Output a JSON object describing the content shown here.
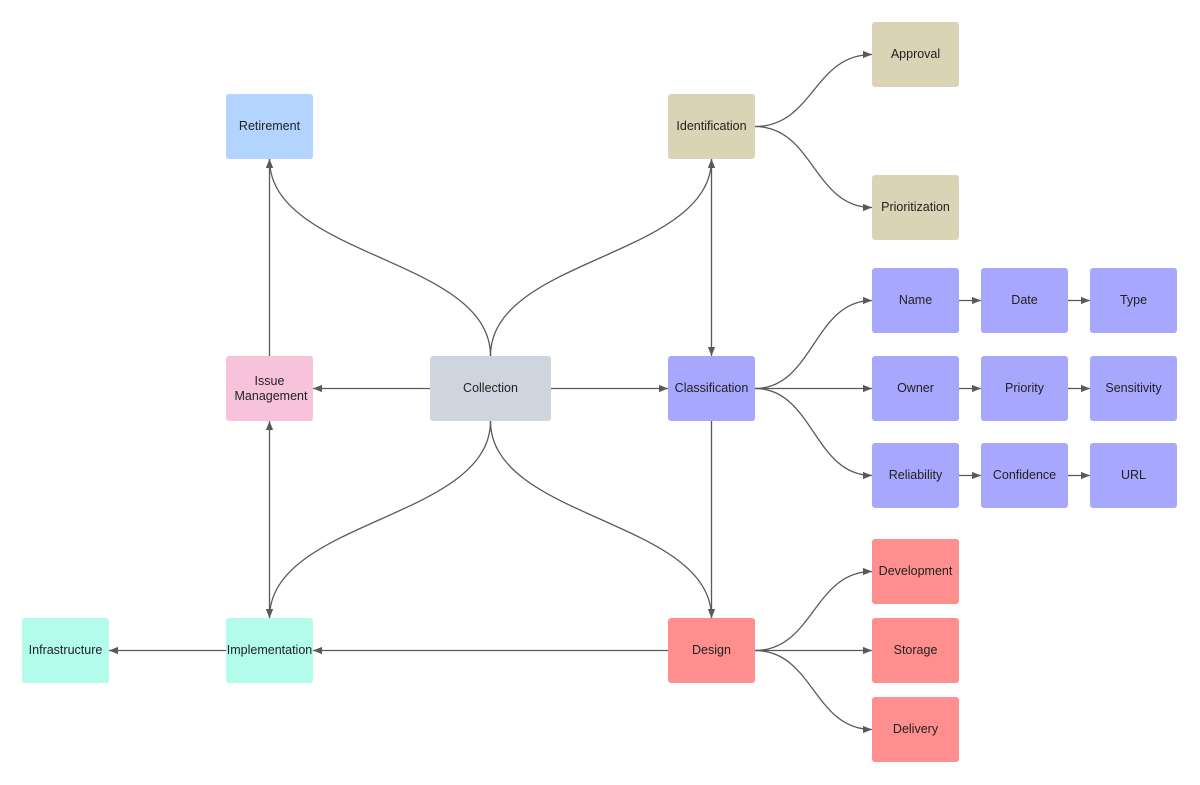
{
  "diagram": {
    "edge_color": "#595959",
    "nodes": [
      {
        "id": "retirement",
        "label": "Retirement",
        "color": "#b3d4ff"
      },
      {
        "id": "identification",
        "label": "Identification",
        "color": "#dbd3b5"
      },
      {
        "id": "approval",
        "label": "Approval",
        "color": "#dbd3b5"
      },
      {
        "id": "prioritization",
        "label": "Prioritization",
        "color": "#dbd3b5"
      },
      {
        "id": "issue",
        "label": "Issue Management",
        "color": "#f6c3da"
      },
      {
        "id": "collection",
        "label": "Collection",
        "color": "#cfd5de"
      },
      {
        "id": "classification",
        "label": "Classification",
        "color": "#a7a7fd"
      },
      {
        "id": "name",
        "label": "Name",
        "color": "#a7a7fd"
      },
      {
        "id": "date",
        "label": "Date",
        "color": "#a7a7fd"
      },
      {
        "id": "type",
        "label": "Type",
        "color": "#a7a7fd"
      },
      {
        "id": "owner",
        "label": "Owner",
        "color": "#a7a7fd"
      },
      {
        "id": "priority",
        "label": "Priority",
        "color": "#a7a7fd"
      },
      {
        "id": "sensitivity",
        "label": "Sensitivity",
        "color": "#a7a7fd"
      },
      {
        "id": "reliability",
        "label": "Reliability",
        "color": "#a7a7fd"
      },
      {
        "id": "confidence",
        "label": "Confidence",
        "color": "#a7a7fd"
      },
      {
        "id": "url",
        "label": "URL",
        "color": "#a7a7fd"
      },
      {
        "id": "design",
        "label": "Design",
        "color": "#ff8f8f"
      },
      {
        "id": "development",
        "label": "Development",
        "color": "#ff8f8f"
      },
      {
        "id": "storage",
        "label": "Storage",
        "color": "#ff8f8f"
      },
      {
        "id": "delivery",
        "label": "Delivery",
        "color": "#ff8f8f"
      },
      {
        "id": "implementation",
        "label": "Implementation",
        "color": "#b3fbeb"
      },
      {
        "id": "infrastructure",
        "label": "Infrastructure",
        "color": "#b3fbeb"
      }
    ],
    "edges": [
      {
        "from": "collection",
        "to": "retirement"
      },
      {
        "from": "collection",
        "to": "identification"
      },
      {
        "from": "collection",
        "to": "issue"
      },
      {
        "from": "collection",
        "to": "classification"
      },
      {
        "from": "collection",
        "to": "implementation"
      },
      {
        "from": "collection",
        "to": "design"
      },
      {
        "from": "issue",
        "to": "retirement"
      },
      {
        "from": "classification",
        "to": "identification",
        "bidirectional": true
      },
      {
        "from": "implementation",
        "to": "issue",
        "bidirectional": true
      },
      {
        "from": "classification",
        "to": "design"
      },
      {
        "from": "design",
        "to": "implementation"
      },
      {
        "from": "implementation",
        "to": "infrastructure"
      },
      {
        "from": "identification",
        "to": "approval"
      },
      {
        "from": "identification",
        "to": "prioritization"
      },
      {
        "from": "classification",
        "to": "name"
      },
      {
        "from": "classification",
        "to": "owner"
      },
      {
        "from": "classification",
        "to": "reliability"
      },
      {
        "from": "name",
        "to": "date"
      },
      {
        "from": "date",
        "to": "type"
      },
      {
        "from": "owner",
        "to": "priority"
      },
      {
        "from": "priority",
        "to": "sensitivity"
      },
      {
        "from": "reliability",
        "to": "confidence"
      },
      {
        "from": "confidence",
        "to": "url"
      },
      {
        "from": "design",
        "to": "development"
      },
      {
        "from": "design",
        "to": "storage"
      },
      {
        "from": "design",
        "to": "delivery"
      }
    ]
  }
}
